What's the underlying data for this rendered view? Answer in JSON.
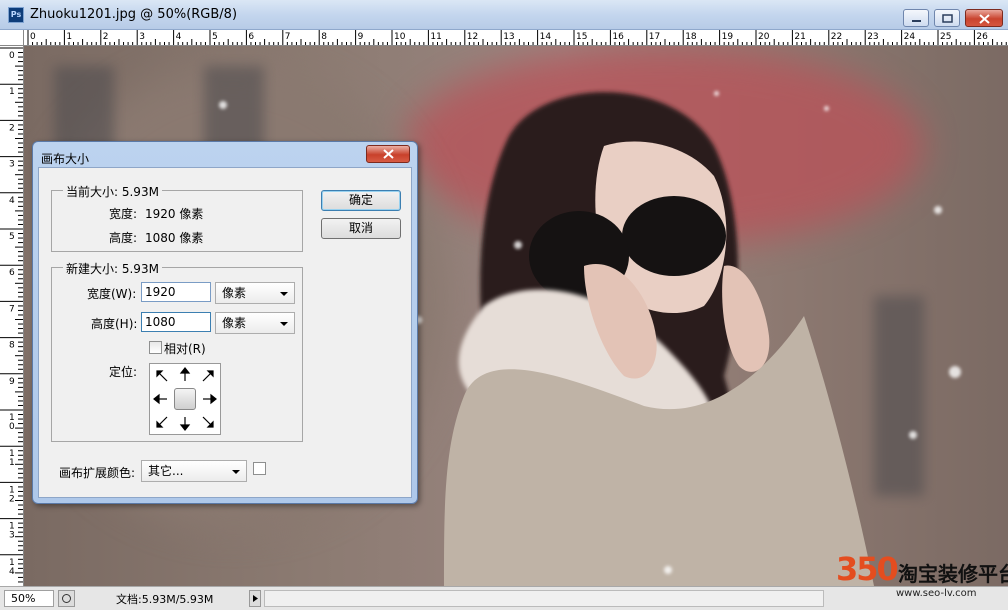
{
  "window": {
    "title": "Zhuoku1201.jpg @ 50%(RGB/8)",
    "app_icon": "Ps"
  },
  "rulers": {
    "top_labels": [
      "0",
      "1",
      "2",
      "3",
      "4",
      "5",
      "6",
      "7",
      "8",
      "9",
      "10",
      "11",
      "12",
      "13",
      "14",
      "15",
      "16",
      "17",
      "18",
      "19",
      "20",
      "21",
      "22",
      "23",
      "24",
      "25",
      "26"
    ],
    "left_labels": [
      "0",
      "1",
      "2",
      "3",
      "4",
      "5",
      "6",
      "7",
      "8",
      "9",
      "10",
      "11",
      "12",
      "13",
      "14"
    ]
  },
  "dialog": {
    "title": "画布大小",
    "current": {
      "legend": "当前大小: 5.93M",
      "width_label": "宽度:",
      "width_value": "1920 像素",
      "height_label": "高度:",
      "height_value": "1080 像素"
    },
    "new": {
      "legend": "新建大小: 5.93M",
      "width_label": "宽度(W):",
      "width_value": "1920",
      "width_unit": "像素",
      "height_label": "高度(H):",
      "height_value": "1080",
      "height_unit": "像素",
      "relative_label": "相对(R)",
      "anchor_label": "定位:"
    },
    "extension": {
      "label": "画布扩展颜色:",
      "value": "其它..."
    },
    "ok_label": "确定",
    "cancel_label": "取消"
  },
  "status": {
    "zoom": "50%",
    "doc_info": "文档:5.93M/5.93M"
  },
  "watermark": {
    "number": "350",
    "text": "淘宝装修平台",
    "url": "www.seo-lv.com"
  }
}
